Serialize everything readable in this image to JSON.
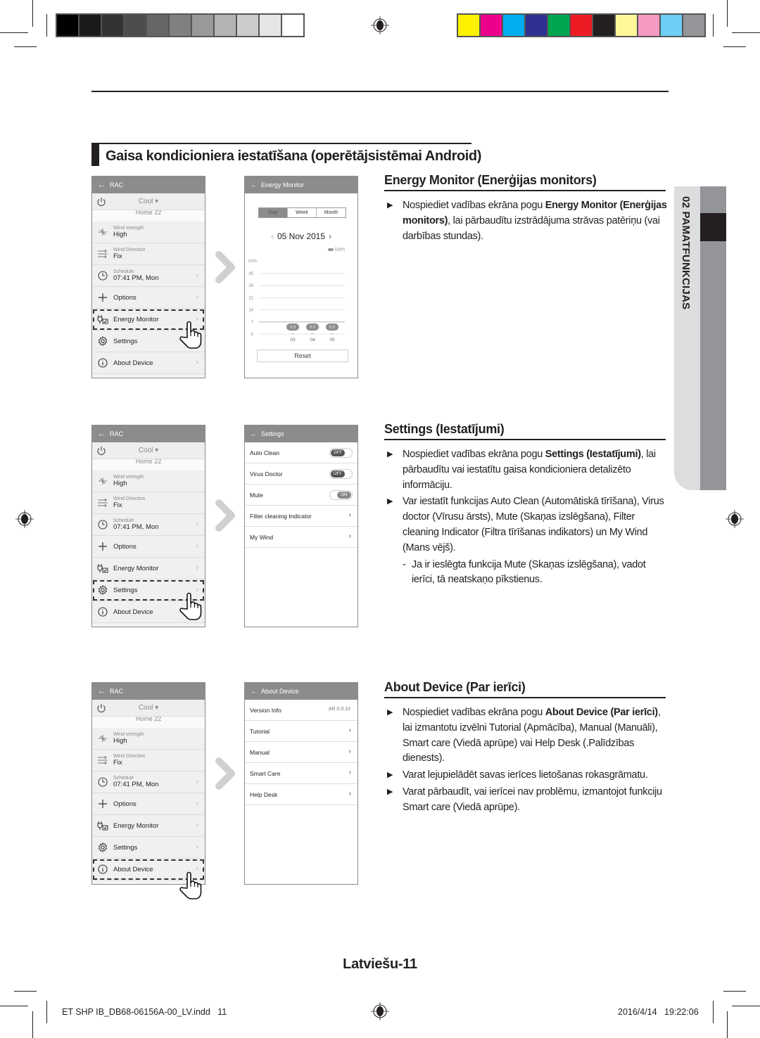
{
  "print_marks": {
    "grayscale_swatches": [
      "#000000",
      "#1a1a1a",
      "#333333",
      "#4d4d4d",
      "#666666",
      "#808080",
      "#999999",
      "#b3b3b3",
      "#cccccc",
      "#e6e6e6",
      "#ffffff"
    ],
    "color_swatches": [
      "#fff200",
      "#ec008c",
      "#00aeef",
      "#2e3192",
      "#00a651",
      "#ed1c24",
      "#231f20",
      "#fff799",
      "#f49ac1",
      "#6dcff6",
      "#939598"
    ]
  },
  "section_title": "Gaisa kondicioniera iestatīšana (operētājsistēmai Android)",
  "side_tab": {
    "label": "02  PAMATFUNKCIJAS"
  },
  "menu_screen": {
    "header": "RAC",
    "mode": "Cool ▾",
    "home_label": "Home 22",
    "rows": [
      {
        "small": "Wind strength",
        "value": "High",
        "icon": "fan-icon"
      },
      {
        "small": "Wind Direction",
        "value": "Fix",
        "icon": "wind-direction-icon"
      },
      {
        "small": "Schedule",
        "value": "07:41 PM, Mon",
        "icon": "clock-icon"
      },
      {
        "label": "Options",
        "icon": "plus-icon"
      },
      {
        "label": "Energy Monitor",
        "icon": "plug-icon"
      },
      {
        "label": "Settings",
        "icon": "gear-icon"
      },
      {
        "label": "About Device",
        "icon": "info-icon"
      }
    ],
    "chevron": "›"
  },
  "energy_monitor_screen": {
    "header": "Energy Monitor",
    "tabs": [
      "Day",
      "Week",
      "Month"
    ],
    "active_tab": "Day",
    "date": "05 Nov 2015",
    "legend": "kWh",
    "unit": "kWh",
    "reset_label": "Reset",
    "chart_data": {
      "type": "bar",
      "title": "",
      "ylabel": "kWh",
      "yticks": [
        0,
        7,
        14,
        21,
        28,
        35
      ],
      "ylim": [
        0,
        35
      ],
      "categories": [
        "03",
        "04",
        "05"
      ],
      "values": [
        0.0,
        0.0,
        0.0
      ],
      "data_labels": [
        "0.0",
        "0.0",
        "0.0"
      ],
      "legend": [
        "kWh"
      ],
      "grid": true
    }
  },
  "settings_screen": {
    "header": "Settings",
    "rows": [
      {
        "label": "Auto Clean",
        "toggle": "OFF"
      },
      {
        "label": "Virus Doctor",
        "toggle": "OFF"
      },
      {
        "label": "Mute",
        "toggle": "ON"
      },
      {
        "label": "Filter cleaning Indicator",
        "chevron": "›"
      },
      {
        "label": "My Wind",
        "chevron": "›"
      }
    ]
  },
  "about_screen": {
    "header": "About Device",
    "rows": [
      {
        "label": "Version Info",
        "value": "AR.0.0.10"
      },
      {
        "label": "Tutorial",
        "chevron": "›"
      },
      {
        "label": "Manual",
        "chevron": "›"
      },
      {
        "label": "Smart Care",
        "chevron": "›"
      },
      {
        "label": "Help Desk",
        "chevron": "›"
      }
    ]
  },
  "energy_section": {
    "heading": "Energy Monitor (Enerģijas monitors)",
    "b1_pre": "Nospiediet vadības ekrāna pogu ",
    "b1_bold": "Energy Monitor (Enerģijas monitors)",
    "b1_post": ", lai pārbaudītu izstrādājuma strāvas patēriņu (vai darbības stundas)."
  },
  "settings_section": {
    "heading": "Settings (Iestatījumi)",
    "b1_pre": "Nospiediet vadības ekrāna pogu ",
    "b1_bold": "Settings (Iestatījumi)",
    "b1_post": ", lai pārbaudītu vai iestatītu gaisa kondicioniera detalizēto informāciju.",
    "b2": "Var iestatīt funkcijas Auto Clean (Automātiskā tīrīšana), Virus doctor (Vīrusu ārsts), Mute (Skaņas izslēgšana), Filter cleaning Indicator (Filtra tīrīšanas indikators) un My Wind (Mans vējš).",
    "d1": "Ja ir ieslēgta funkcija Mute (Skaņas izslēgšana), vadot ierīci, tā neatskaņo pīkstienus."
  },
  "about_section": {
    "heading": "About Device (Par ierīci)",
    "b1_pre": "Nospiediet vadības ekrāna pogu ",
    "b1_bold": "About Device (Par ierīci)",
    "b1_post": ", lai izmantotu izvēlni Tutorial (Apmācība), Manual (Manuāli), Smart care (Viedā aprūpe) vai Help Desk (.Palīdzības dienests).",
    "b2": "Varat lejupielādēt savas ierīces lietošanas rokasgrāmatu.",
    "b3": "Varat pārbaudīt, vai ierīcei nav problēmu, izmantojot funkciju Smart care (Viedā aprūpe)."
  },
  "page_number": "Latviešu-11",
  "footer": {
    "file": "ET SHP IB_DB68-06156A-00_LV.indd   11",
    "timestamp": "2016/4/14   19:22:06"
  }
}
